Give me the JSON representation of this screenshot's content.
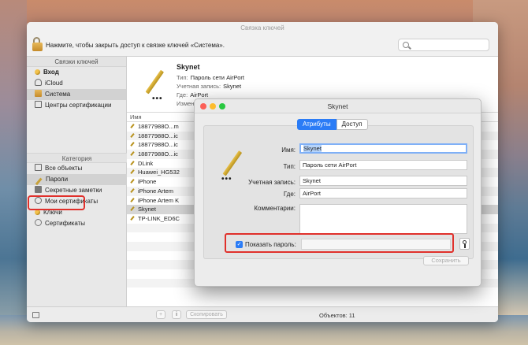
{
  "window": {
    "title": "Связка ключей",
    "toolbar_text": "Нажмите, чтобы закрыть доступ к связке ключей «Система».",
    "search_placeholder": ""
  },
  "sidebar": {
    "keychains_header": "Связки ключей",
    "keychains": [
      {
        "label": "Вход",
        "icon": "key-icon"
      },
      {
        "label": "iCloud",
        "icon": "cloud-icon"
      },
      {
        "label": "Система",
        "icon": "lock-icon"
      },
      {
        "label": "Центры сертификации",
        "icon": "cabinet-icon"
      }
    ],
    "category_header": "Категория",
    "categories": [
      {
        "label": "Все объекты",
        "icon": "all-items-icon"
      },
      {
        "label": "Пароли",
        "icon": "pencil-icon"
      },
      {
        "label": "Секретные заметки",
        "icon": "note-icon"
      },
      {
        "label": "Мои сертификаты",
        "icon": "person-icon"
      },
      {
        "label": "Ключи",
        "icon": "key-icon"
      },
      {
        "label": "Сертификаты",
        "icon": "certificate-icon"
      }
    ]
  },
  "detail": {
    "name": "Skynet",
    "type_label": "Тип:",
    "type_value": "Пароль сети AirPort",
    "account_label": "Учетная запись:",
    "account_value": "Skynet",
    "where_label": "Где:",
    "where_value": "AirPort",
    "modified_label": "Измен"
  },
  "table": {
    "column_name": "Имя",
    "rows": [
      "18877988О...m",
      "18877988О...ic",
      "18877988О...ic",
      "18877988О...ic",
      "DLink",
      "Huawei_HG532",
      "iPhone",
      "iPhone Artem",
      "iPhone Artem K",
      "Skynet",
      "TP-LINK_ED6C"
    ],
    "selected_index": 9
  },
  "bottombar": {
    "add_label": "+",
    "info_label": "i",
    "copy_label": "Скопировать",
    "count_text": "Объектов: 11"
  },
  "dialog": {
    "title": "Skynet",
    "tabs": [
      "Атрибуты",
      "Доступ"
    ],
    "active_tab": 0,
    "name_label": "Имя:",
    "name_value": "Skynet",
    "kind_label": "Тип:",
    "kind_value": "Пароль сети AirPort",
    "account_label": "Учетная запись:",
    "account_value": "Skynet",
    "where_label": "Где:",
    "where_value": "AirPort",
    "comments_label": "Комментарии:",
    "show_password_label": "Показать пароль:",
    "show_password_checked": true,
    "password_value": "",
    "save_label": "Сохранить"
  },
  "colors": {
    "accent": "#2b7cf6",
    "highlight": "#e0302b"
  }
}
